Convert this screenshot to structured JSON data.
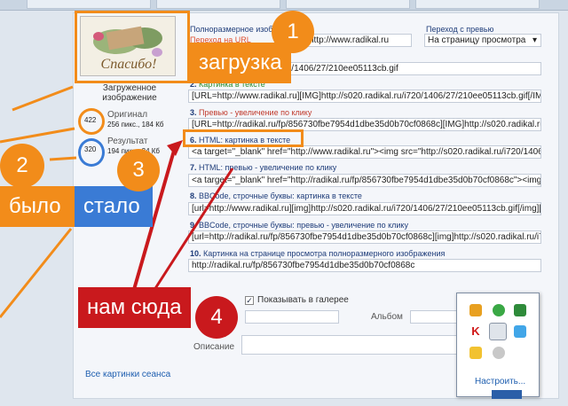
{
  "header": {
    "fullsize_label": "Полноразмерное изображение",
    "fullsize_hint": "Переход на URL",
    "url_value": "http://www.radikal.ru",
    "preview_label": "Переход с превью",
    "preview_select": "На страницу просмотра"
  },
  "left": {
    "loaded_label": "Загруженное изображение",
    "original_label": "Оригинал",
    "original_value": "422",
    "original_info": "256 пикс., 184 Кб",
    "result_label": "Результат",
    "result_value": "320",
    "result_info": "194 пикс., 34 Кб",
    "session_link": "Все картинки сеанса"
  },
  "rows": [
    {
      "num": "1.",
      "title": "",
      "value": "http://s020.radikal.ru/i720/1406/27/210ee05113cb.gif"
    },
    {
      "num": "2.",
      "title": "Картинка в тексте",
      "value": "[URL=http://www.radikal.ru][IMG]http://s020.radikal.ru/i720/1406/27/210ee05113cb.gif[/IMG][/URL]"
    },
    {
      "num": "3.",
      "title": "Превью - увеличение по клику",
      "value": "[URL=http://radikal.ru/fp/856730fbe7954d1dbe35d0b70cf0868c][IMG]http://s020.radikal.ru/i720/1406/27/210ee05113cbt.jpg[/IMG][/URL]"
    },
    {
      "num": "6.",
      "title": "HTML: картинка в тексте",
      "value": "<a target=\"_blank\" href=\"http://www.radikal.ru\"><img src=\"http://s020.radikal.ru/i720/1406/27/210ee05113cb.gif\" ></a>"
    },
    {
      "num": "7.",
      "title": "HTML: превью - увеличение по клику",
      "value": "<a target=\"_blank\" href=\"http://radikal.ru/fp/856730fbe7954d1dbe35d0b70cf0868c\"><img src=\"http://s020.radikal.ru/i720/1406/27/210ee05113cbt.jpg\" ></a>"
    },
    {
      "num": "8.",
      "title": "BBCode, строчные буквы: картинка в тексте",
      "value": "[url=http://www.radikal.ru][img]http://s020.radikal.ru/i720/1406/27/210ee05113cb.gif[/img][/url]"
    },
    {
      "num": "9.",
      "title": "BBCode, строчные буквы: превью - увеличение по клику",
      "value": "[url=http://radikal.ru/fp/856730fbe7954d1dbe35d0b70cf0868c][img]http://s020.radikal.ru/i720/1406/27/210ee05113cbt.jpg[/img][/url]"
    },
    {
      "num": "10.",
      "title": "Картинка на странице просмотра полноразмерного изображения",
      "value": "http://radikal.ru/fp/856730fbe7954d1dbe35d0b70cf0868c"
    }
  ],
  "gallery": {
    "checkbox_label": "Показывать в галерее",
    "album_label": "Альбом",
    "description_label": "Описание"
  },
  "tray": {
    "configure_link": "Настроить..."
  },
  "annotations": {
    "b1": "1",
    "b2": "2",
    "b3": "3",
    "b4": "4",
    "upload": "загрузка",
    "was": "было",
    "became": "стало",
    "here": "нам сюда"
  },
  "colors": {
    "orange": "#f28c1a",
    "red": "#c9191d",
    "blue": "#3a7bd5"
  }
}
